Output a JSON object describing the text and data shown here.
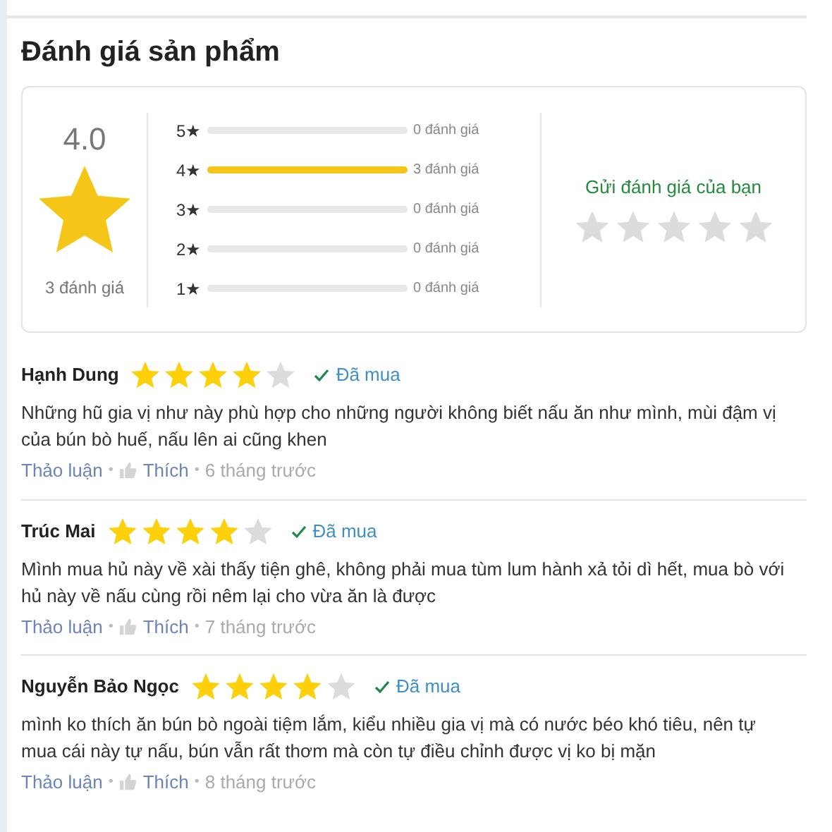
{
  "title": "Đánh giá sản phẩm",
  "summary": {
    "average": "4.0",
    "count": "3 đánh giá",
    "bars": [
      {
        "label": "5★",
        "level": 0,
        "count": "0 đánh giá"
      },
      {
        "label": "4★",
        "level": 1,
        "count": "3 đánh giá"
      },
      {
        "label": "3★",
        "level": 0,
        "count": "0 đánh giá"
      },
      {
        "label": "2★",
        "level": 0,
        "count": "0 đánh giá"
      },
      {
        "label": "1★",
        "level": 0,
        "count": "0 đánh giá"
      }
    ],
    "submit": {
      "label": "Gửi đánh giá của bạn",
      "stars": 0
    }
  },
  "reviews": [
    {
      "name": "Hạnh Dung",
      "stars": 4,
      "verified": "Đã mua",
      "text": "Những hũ gia vị như này phù hợp cho những người không biết nấu ăn như mình, mùi đậm vị của bún bò huế, nấu lên ai cũng khen",
      "discuss": "Thảo luận",
      "like": "Thích",
      "time": "6 tháng trước"
    },
    {
      "name": "Trúc Mai",
      "stars": 4,
      "verified": "Đã mua",
      "text": "Mình mua hủ này về xài thấy tiện ghê, không phải mua tùm lum hành xả tỏi dì hết, mua bò với hủ này về nấu cùng rồi nêm lại cho vừa ăn là được",
      "discuss": "Thảo luận",
      "like": "Thích",
      "time": "7 tháng trước"
    },
    {
      "name": "Nguyễn Bảo Ngọc",
      "stars": 4,
      "verified": "Đã mua",
      "text": "mình ko thích ăn bún bò ngoài tiệm lắm, kiểu nhiều gia vị mà có nước béo khó tiêu, nên tự mua cái này tự nấu, bún vẫn rất thơm mà còn tự điều chỉnh được vị ko bị mặn",
      "discuss": "Thảo luận",
      "like": "Thích",
      "time": "8 tháng trước"
    }
  ],
  "separator": "•"
}
